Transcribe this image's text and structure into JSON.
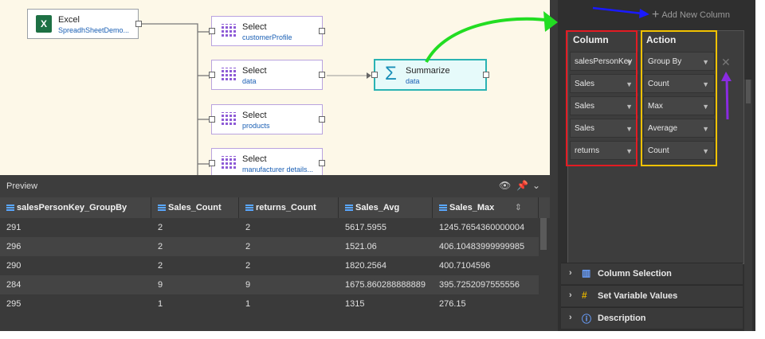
{
  "canvas": {
    "source": {
      "title": "Excel",
      "subtitle": "SpreadhSheetDemo...",
      "icon": "excel-icon"
    },
    "selects": [
      {
        "title": "Select",
        "subtitle": "customerProfile"
      },
      {
        "title": "Select",
        "subtitle": "data"
      },
      {
        "title": "Select",
        "subtitle": "products"
      },
      {
        "title": "Select",
        "subtitle": "manufacturer details..."
      }
    ],
    "summarize": {
      "title": "Summarize",
      "subtitle": "data",
      "icon": "sigma-icon"
    }
  },
  "preview": {
    "title": "Preview",
    "columns": [
      "salesPersonKey_GroupBy",
      "Sales_Count",
      "returns_Count",
      "Sales_Avg",
      "Sales_Max"
    ],
    "rows": [
      [
        "291",
        "2",
        "2",
        "5617.5955",
        "1245.7654360000004"
      ],
      [
        "296",
        "2",
        "2",
        "1521.06",
        "406.10483999999985"
      ],
      [
        "290",
        "2",
        "2",
        "1820.2564",
        "400.7104596"
      ],
      [
        "284",
        "9",
        "9",
        "1675.860288888889",
        "395.7252097555556"
      ],
      [
        "295",
        "1",
        "1",
        "1315",
        "276.15"
      ]
    ]
  },
  "panel": {
    "add_column": "Add New Column",
    "headers": {
      "column": "Column",
      "action": "Action"
    },
    "rules": [
      {
        "column": "salesPersonKey",
        "action": "Group By"
      },
      {
        "column": "Sales",
        "action": "Count"
      },
      {
        "column": "Sales",
        "action": "Max"
      },
      {
        "column": "Sales",
        "action": "Average"
      },
      {
        "column": "returns",
        "action": "Count"
      }
    ],
    "sections": [
      {
        "label": "Column Selection",
        "icon": "column-selection-icon"
      },
      {
        "label": "Set Variable Values",
        "icon": "variable-icon"
      },
      {
        "label": "Description",
        "icon": "info-icon"
      }
    ]
  },
  "annotations": {
    "colors": {
      "red": "#e31b23",
      "yellow": "#f2c200",
      "green": "#22dd22",
      "blue": "#1a1aff",
      "purple": "#8a2be2"
    }
  }
}
